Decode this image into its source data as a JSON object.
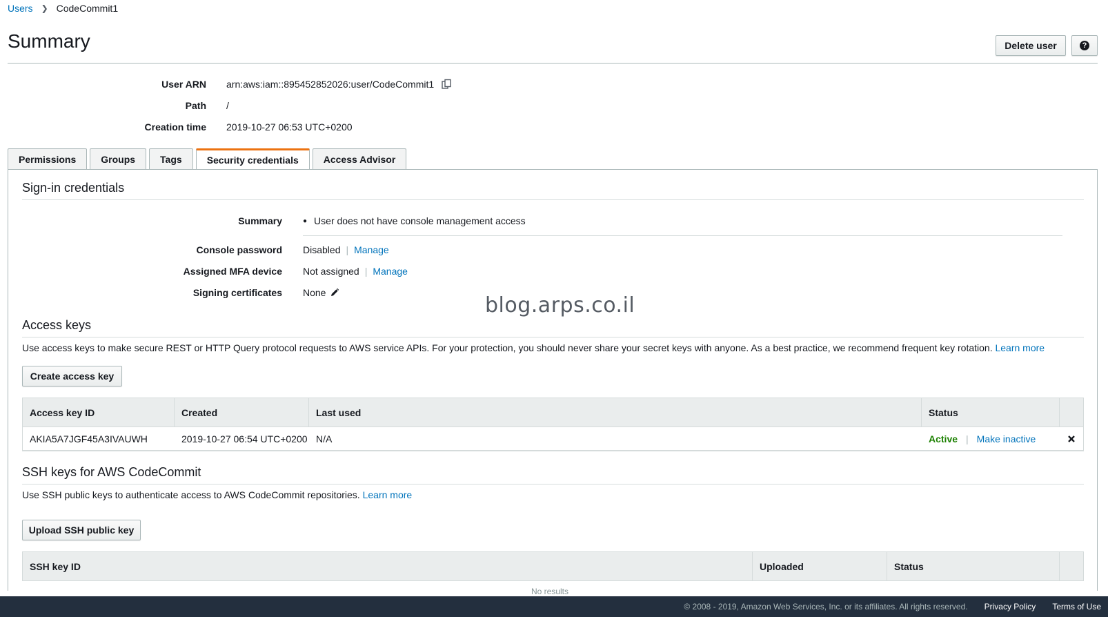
{
  "breadcrumb": {
    "parent": "Users",
    "current": "CodeCommit1"
  },
  "header": {
    "title": "Summary",
    "delete_label": "Delete user",
    "help_label": "?"
  },
  "meta": {
    "arn_label": "User ARN",
    "arn_value": "arn:aws:iam::895452852026:user/CodeCommit1",
    "path_label": "Path",
    "path_value": "/",
    "created_label": "Creation time",
    "created_value": "2019-10-27 06:53 UTC+0200"
  },
  "tabs": [
    "Permissions",
    "Groups",
    "Tags",
    "Security credentials",
    "Access Advisor"
  ],
  "signin": {
    "title": "Sign-in credentials",
    "summary_label": "Summary",
    "summary_value": "User does not have console management access",
    "console_label": "Console password",
    "console_value": "Disabled",
    "console_action": "Manage",
    "mfa_label": "Assigned MFA device",
    "mfa_value": "Not assigned",
    "mfa_action": "Manage",
    "signing_label": "Signing certificates",
    "signing_value": "None"
  },
  "watermark": "blog.arps.co.il",
  "access_keys": {
    "title": "Access keys",
    "description": "Use access keys to make secure REST or HTTP Query protocol requests to AWS service APIs. For your protection, you should never share your secret keys with anyone. As a best practice, we recommend frequent key rotation.",
    "learn_more": "Learn more",
    "create_label": "Create access key",
    "columns": [
      "Access key ID",
      "Created",
      "Last used",
      "Status"
    ],
    "rows": [
      {
        "id": "AKIA5A7JGF45A3IVAUWH",
        "created": "2019-10-27 06:54 UTC+0200",
        "last_used": "N/A",
        "status": "Active",
        "action": "Make inactive"
      }
    ]
  },
  "ssh": {
    "title": "SSH keys for AWS CodeCommit",
    "description": "Use SSH public keys to authenticate access to AWS CodeCommit repositories.",
    "learn_more": "Learn more",
    "upload_label": "Upload SSH public key",
    "columns": [
      "SSH key ID",
      "Uploaded",
      "Status"
    ],
    "empty": "No results"
  },
  "footer": {
    "copyright": "© 2008 - 2019, Amazon Web Services, Inc. or its affiliates. All rights reserved.",
    "privacy": "Privacy Policy",
    "terms": "Terms of Use"
  },
  "colors": {
    "link": "#0073bb",
    "active": "#1d8102",
    "tab_accent": "#ec7211",
    "footer_bg": "#232f3e"
  }
}
